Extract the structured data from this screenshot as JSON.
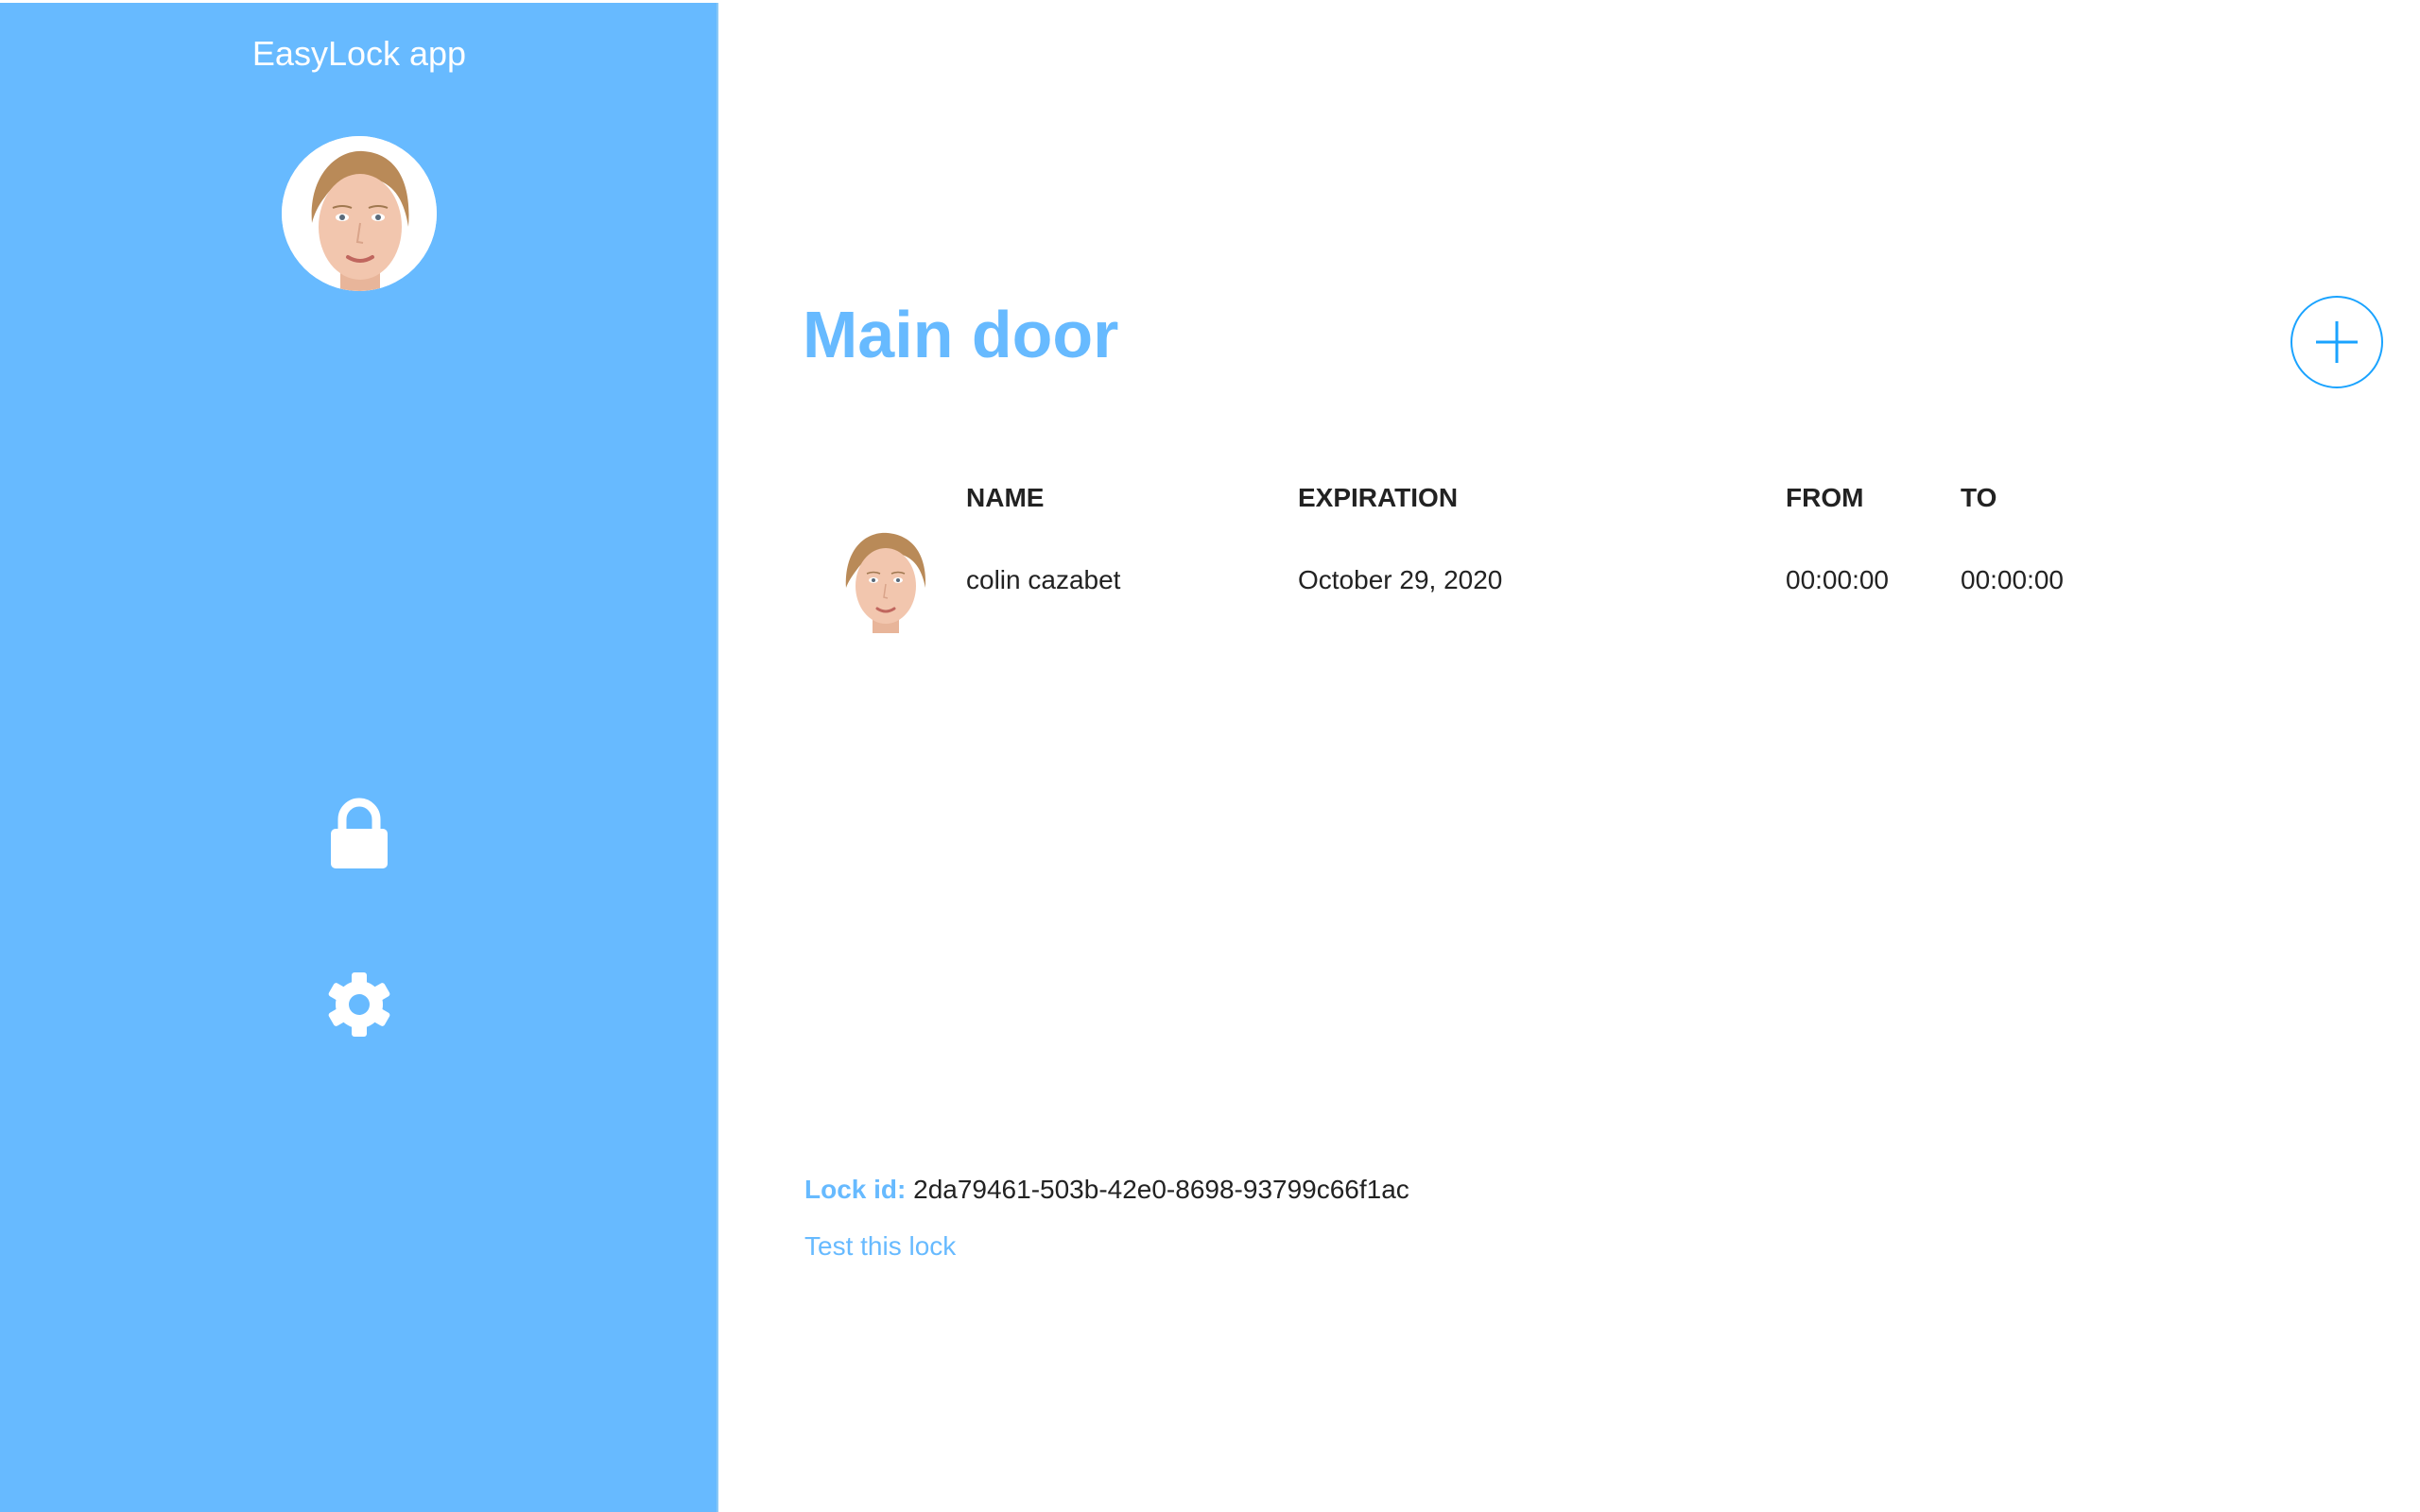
{
  "sidebar": {
    "app_title": "EasyLock app",
    "avatar_icon": "user-face-avatar",
    "nav": [
      {
        "icon": "lock-icon"
      },
      {
        "icon": "gear-icon"
      }
    ]
  },
  "main": {
    "title": "Main door",
    "add_icon": "plus-icon",
    "table": {
      "headers": [
        "NAME",
        "EXPIRATION",
        "FROM",
        "TO"
      ],
      "rows": [
        {
          "avatar": "user-face-avatar",
          "name": "colin cazabet",
          "expiration": "October 29, 2020",
          "from": "00:00:00",
          "to": "00:00:00"
        }
      ]
    },
    "lock_id_label": "Lock id:",
    "lock_id_value": "2da79461-503b-42e0-8698-93799c66f1ac",
    "test_link": "Test this lock"
  },
  "colors": {
    "accent": "#67baff",
    "add_button": "#1aa3ff",
    "text": "#222222",
    "background": "#ffffff"
  }
}
